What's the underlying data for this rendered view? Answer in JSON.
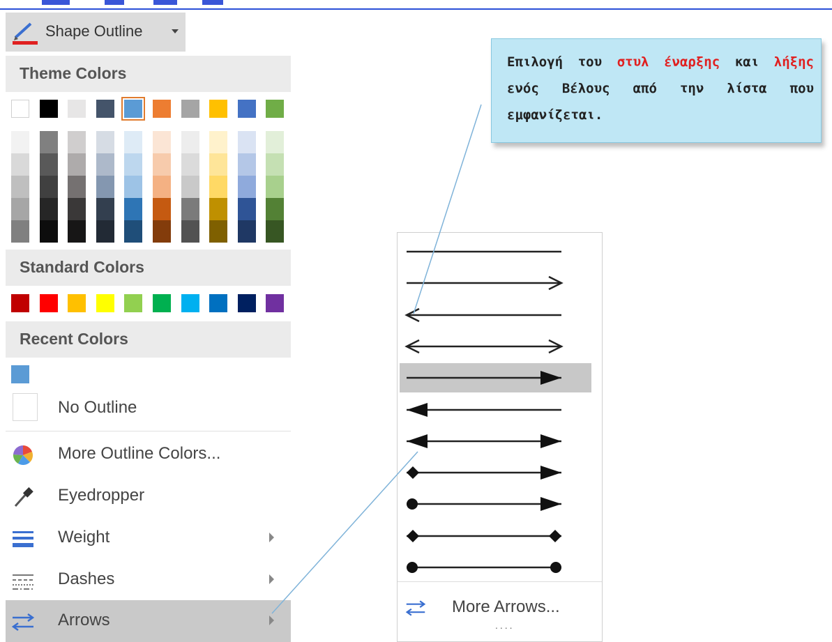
{
  "button": {
    "label": "Shape Outline",
    "icon": "pen-outline-icon",
    "underline_color": "#e02020"
  },
  "sections": {
    "theme": "Theme Colors",
    "standard": "Standard Colors",
    "recent": "Recent Colors"
  },
  "theme_colors": [
    "#ffffff",
    "#000000",
    "#e7e6e6",
    "#44546a",
    "#5b9bd5",
    "#ed7d31",
    "#a5a5a5",
    "#ffc000",
    "#4472c4",
    "#70ad47"
  ],
  "theme_selected_index": 4,
  "theme_shades": [
    [
      "#f2f2f2",
      "#d9d9d9",
      "#bfbfbf",
      "#a6a6a6",
      "#808080"
    ],
    [
      "#808080",
      "#595959",
      "#404040",
      "#262626",
      "#0d0d0d"
    ],
    [
      "#d0cece",
      "#aeabab",
      "#757171",
      "#3a3838",
      "#171616"
    ],
    [
      "#d6dce4",
      "#adb9ca",
      "#8497b0",
      "#333f4f",
      "#222a35"
    ],
    [
      "#deebf6",
      "#bdd7ee",
      "#9dc3e6",
      "#2e75b5",
      "#1f4e79"
    ],
    [
      "#fbe5d5",
      "#f7cbac",
      "#f4b183",
      "#c55a11",
      "#833c0b"
    ],
    [
      "#ededed",
      "#dbdbdb",
      "#c9c9c9",
      "#7b7b7b",
      "#525252"
    ],
    [
      "#fff2cc",
      "#fee599",
      "#ffd965",
      "#bf9000",
      "#7f6000"
    ],
    [
      "#dae3f3",
      "#b4c7e7",
      "#8faadc",
      "#2f5496",
      "#1f3864"
    ],
    [
      "#e2efd9",
      "#c5e0b3",
      "#a8d08d",
      "#538135",
      "#375623"
    ]
  ],
  "standard_colors": [
    "#c00000",
    "#ff0000",
    "#ffc000",
    "#ffff00",
    "#92d050",
    "#00b050",
    "#00b0f0",
    "#0070c0",
    "#002060",
    "#7030a0"
  ],
  "recent_colors": [
    "#5b9bd5"
  ],
  "menu": {
    "no_outline": "No Outline",
    "more_colors": "More Outline Colors...",
    "eyedropper": "Eyedropper",
    "weight": "Weight",
    "dashes": "Dashes",
    "arrows": "Arrows"
  },
  "arrow_styles": [
    "plain-line",
    "open-end",
    "open-start",
    "open-both",
    "filled-end",
    "filled-start",
    "filled-both",
    "diamond-start-filled-end",
    "dot-start-filled-end",
    "diamond-both",
    "dot-both"
  ],
  "arrow_selected_index": 4,
  "gallery": {
    "more_label": "More Arrows...",
    "dots": "...."
  },
  "callout": {
    "t1": "Επιλογή του ",
    "t2": "στυλ έναρξης",
    "t3": " και ",
    "t4": "λήξης",
    "t5": " ενός Βέλους από την λίστα που εμφανίζεται.",
    "bg": "#bfe7f5"
  }
}
